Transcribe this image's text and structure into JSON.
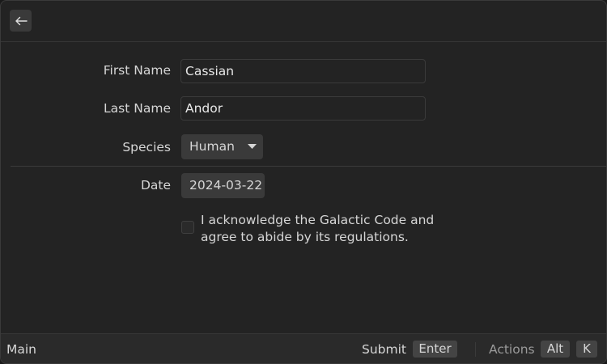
{
  "header": {
    "back_icon": "arrow-left-icon"
  },
  "form": {
    "first_name": {
      "label": "First Name",
      "value": "Cassian"
    },
    "last_name": {
      "label": "Last Name",
      "value": "Andor"
    },
    "species": {
      "label": "Species",
      "value": "Human"
    },
    "date": {
      "label": "Date",
      "value": "2024-03-22"
    },
    "acknowledge": {
      "label": "I acknowledge the Galactic Code and agree to abide by its regulations.",
      "checked": false
    }
  },
  "statusbar": {
    "left_text": "Main",
    "submit_label": "Submit",
    "submit_key": "Enter",
    "actions_label": "Actions",
    "actions_key_1": "Alt",
    "actions_key_2": "K"
  }
}
